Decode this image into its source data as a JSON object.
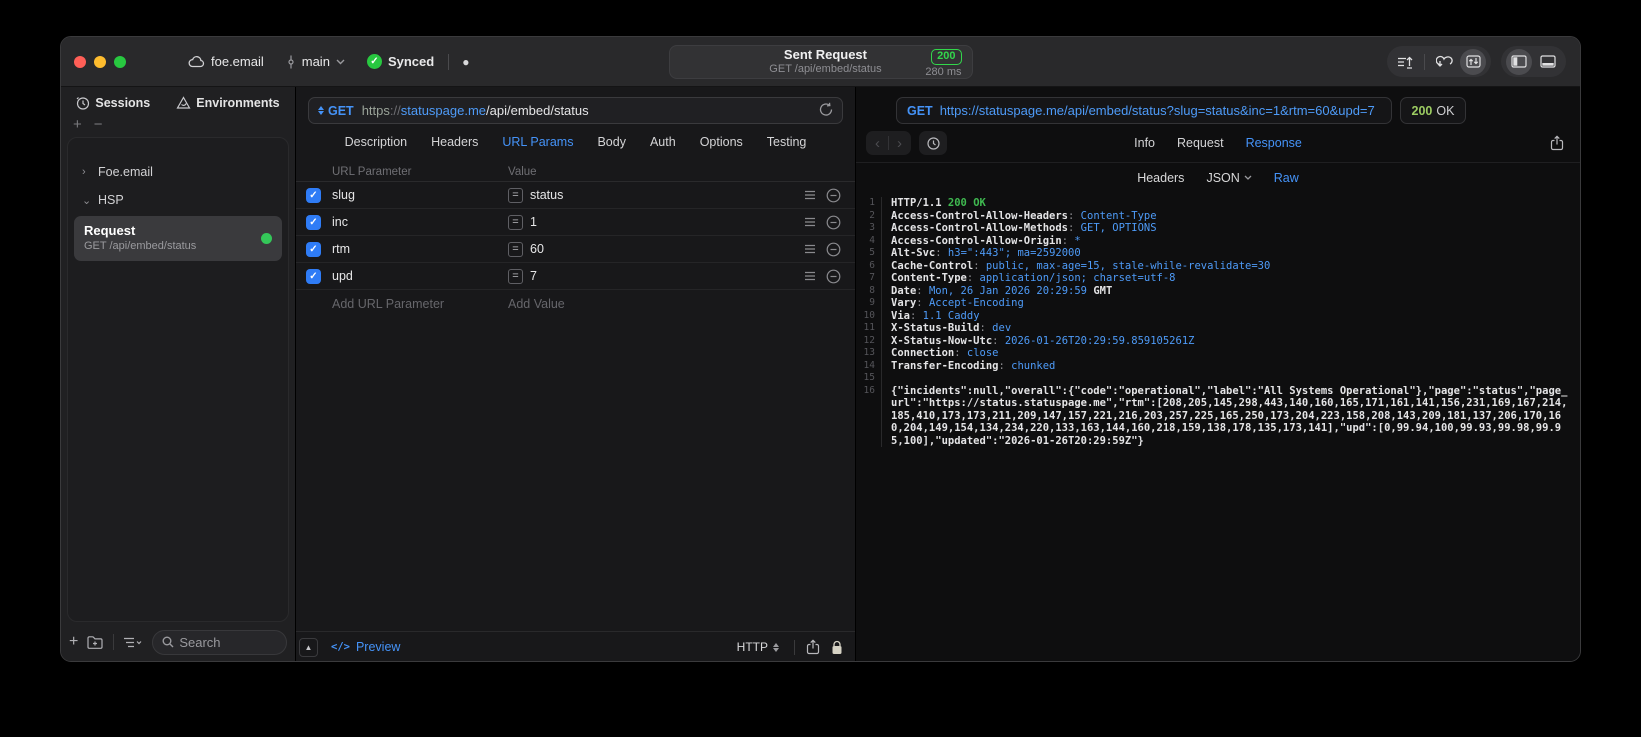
{
  "titlebar": {
    "project": "foe.email",
    "branch": "main",
    "sync_status": "Synced",
    "title": "Sent Request",
    "subtitle": "GET /api/embed/status",
    "status_code": "200",
    "duration": "280 ms"
  },
  "sidebar": {
    "tabs": {
      "sessions": "Sessions",
      "environments": "Environments"
    },
    "tree": {
      "group1": "Foe.email",
      "group2": "HSP"
    },
    "request": {
      "name": "Request",
      "subtitle": "GET /api/embed/status"
    },
    "search_placeholder": "Search"
  },
  "request_pane": {
    "method": "GET",
    "url": {
      "scheme": "https",
      "sep": "://",
      "host": "statuspage.me",
      "path": "/api/embed/status"
    },
    "tabs": [
      "Description",
      "Headers",
      "URL Params",
      "Body",
      "Auth",
      "Options",
      "Testing"
    ],
    "active_tab": "URL Params",
    "table": {
      "col_param": "URL Parameter",
      "col_value": "Value",
      "rows": [
        {
          "name": "slug",
          "value": "status",
          "enabled": true
        },
        {
          "name": "inc",
          "value": "1",
          "enabled": true
        },
        {
          "name": "rtm",
          "value": "60",
          "enabled": true
        },
        {
          "name": "upd",
          "value": "7",
          "enabled": true
        }
      ],
      "add_param": "Add URL Parameter",
      "add_value": "Add Value"
    },
    "footer": {
      "preview": "Preview",
      "protocol": "HTTP"
    }
  },
  "response_pane": {
    "method": "GET",
    "url": "https://statuspage.me/api/embed/status?slug=status&inc=1&rtm=60&upd=7",
    "status_code": "200",
    "status_text": "OK",
    "tabs": [
      "Info",
      "Request",
      "Response"
    ],
    "active_tab": "Response",
    "subtabs": [
      "Headers",
      "JSON",
      "Raw"
    ],
    "active_subtab": "Raw",
    "code": {
      "lines": [
        {
          "n": "1",
          "parts": [
            {
              "t": "HTTP/1.1 ",
              "c": "w"
            },
            {
              "t": "200 OK",
              "c": "g"
            }
          ]
        },
        {
          "n": "2",
          "parts": [
            {
              "t": "Access-Control-Allow-Headers",
              "c": "k"
            },
            {
              "t": ": ",
              "c": "p"
            },
            {
              "t": "Content-Type",
              "c": "v"
            }
          ]
        },
        {
          "n": "3",
          "parts": [
            {
              "t": "Access-Control-Allow-Methods",
              "c": "k"
            },
            {
              "t": ": ",
              "c": "p"
            },
            {
              "t": "GET, OPTIONS",
              "c": "v"
            }
          ]
        },
        {
          "n": "4",
          "parts": [
            {
              "t": "Access-Control-Allow-Origin",
              "c": "k"
            },
            {
              "t": ": ",
              "c": "p"
            },
            {
              "t": "*",
              "c": "v"
            }
          ]
        },
        {
          "n": "5",
          "parts": [
            {
              "t": "Alt-Svc",
              "c": "k"
            },
            {
              "t": ": ",
              "c": "p"
            },
            {
              "t": "h3=\":443\"; ma=2592000",
              "c": "v"
            }
          ]
        },
        {
          "n": "6",
          "parts": [
            {
              "t": "Cache-Control",
              "c": "k"
            },
            {
              "t": ": ",
              "c": "p"
            },
            {
              "t": "public, max-age=15, stale-while-revalidate=30",
              "c": "v"
            }
          ]
        },
        {
          "n": "7",
          "parts": [
            {
              "t": "Content-Type",
              "c": "k"
            },
            {
              "t": ": ",
              "c": "p"
            },
            {
              "t": "application/json; charset=utf-8",
              "c": "v"
            }
          ]
        },
        {
          "n": "8",
          "parts": [
            {
              "t": "Date",
              "c": "k"
            },
            {
              "t": ": ",
              "c": "p"
            },
            {
              "t": "Mon, 26 Jan 2026 20:29:59",
              "c": "v"
            },
            {
              "t": " GMT",
              "c": "k"
            }
          ]
        },
        {
          "n": "9",
          "parts": [
            {
              "t": "Vary",
              "c": "k"
            },
            {
              "t": ": ",
              "c": "p"
            },
            {
              "t": "Accept-Encoding",
              "c": "v"
            }
          ]
        },
        {
          "n": "10",
          "parts": [
            {
              "t": "Via",
              "c": "k"
            },
            {
              "t": ": ",
              "c": "p"
            },
            {
              "t": "1.1 Caddy",
              "c": "v"
            }
          ]
        },
        {
          "n": "11",
          "parts": [
            {
              "t": "X-Status-Build",
              "c": "k"
            },
            {
              "t": ": ",
              "c": "p"
            },
            {
              "t": "dev",
              "c": "v"
            }
          ]
        },
        {
          "n": "12",
          "parts": [
            {
              "t": "X-Status-Now-Utc",
              "c": "k"
            },
            {
              "t": ": ",
              "c": "p"
            },
            {
              "t": "2026-01-26T20:29:59.859105261Z",
              "c": "v"
            }
          ]
        },
        {
          "n": "13",
          "parts": [
            {
              "t": "Connection",
              "c": "k"
            },
            {
              "t": ": ",
              "c": "p"
            },
            {
              "t": "close",
              "c": "v"
            }
          ]
        },
        {
          "n": "14",
          "parts": [
            {
              "t": "Transfer-Encoding",
              "c": "k"
            },
            {
              "t": ": ",
              "c": "p"
            },
            {
              "t": "chunked",
              "c": "v"
            }
          ]
        },
        {
          "n": "15",
          "parts": []
        },
        {
          "n": "16",
          "parts": [
            {
              "t": "{\"incidents\":null,\"overall\":{\"code\":\"operational\",\"label\":\"All Systems Operational\"},\"page\":\"status\",\"page_url\":\"https://status.statuspage.me\",\"rtm\":[208,205,145,298,443,140,160,165,171,161,141,156,231,169,167,214,185,410,173,173,211,209,147,157,221,216,203,257,225,165,250,173,204,223,158,208,143,209,181,137,206,170,160,204,149,154,134,234,220,133,163,144,160,218,159,138,178,135,173,141],\"upd\":[0,99.94,100,99.93,99.98,99.95,100],\"updated\":\"2026-01-26T20:29:59Z\"}",
              "c": "w"
            }
          ]
        }
      ]
    }
  },
  "icons": {
    "check": "✓",
    "chevron_right": "›",
    "chevron_down": "⌄",
    "plus": "+",
    "minus": "−",
    "dot": "●",
    "collapse": "▲",
    "equals": "=",
    "code_tag": "</>",
    "back": "‹",
    "forward": "›"
  },
  "colors": {
    "accent_blue": "#4593f8",
    "code_value_blue": "#4e9bf8",
    "badge_green": "#32d74b",
    "code_green": "#3fb950",
    "status_lime": "#9ccc62",
    "checkbox_blue": "#2f7cf6",
    "selected_row": "#3a3a3d"
  }
}
